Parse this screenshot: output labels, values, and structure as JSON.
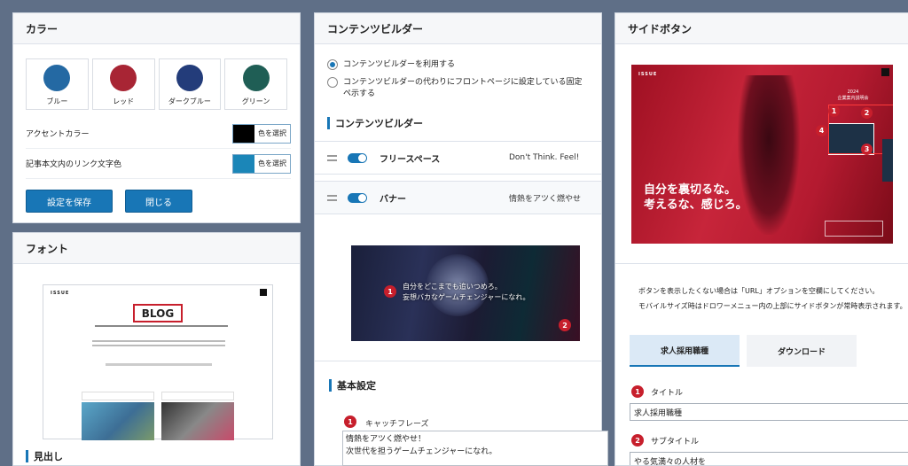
{
  "color_panel": {
    "title": "カラー",
    "swatches": [
      {
        "label": "ブルー",
        "color": "#2469a3"
      },
      {
        "label": "レッド",
        "color": "#a82534"
      },
      {
        "label": "ダークブルー",
        "color": "#233c7a"
      },
      {
        "label": "グリーン",
        "color": "#1f5e55"
      }
    ],
    "accent_label": "アクセントカラー",
    "accent_color": "#000000",
    "link_label": "記事本文内のリンク文字色",
    "link_color": "#1b86b8",
    "pick_label": "色を選択",
    "save_label": "設定を保存",
    "close_label": "閉じる"
  },
  "font_panel": {
    "title": "フォント",
    "preview_logo": "ISSUE",
    "preview_heading": "BLOG",
    "section_label": "見出し"
  },
  "builder_panel": {
    "title": "コンテンツビルダー",
    "radio_use": "コンテンツビルダーを利用する",
    "radio_fixed": "コンテンツビルダーの代わりにフロントページに設定している固定ペ示する",
    "section_title": "コンテンツビルダー",
    "rows": [
      {
        "name": "フリースペース",
        "desc": "Don't Think. Feel!"
      },
      {
        "name": "バナー",
        "desc": "情熱をアツく燃やせ"
      }
    ],
    "banner_text_1": "自分をどこまでも追いつめろ。",
    "banner_text_2": "妄想バカなゲームチェンジャーになれ。",
    "basic_settings": "基本設定",
    "catchphrase_label": "キャッチフレーズ",
    "catchphrase_line1": "情熱をアツく燃やせ！",
    "catchphrase_line2": "次世代を担うゲームチェンジャーになれ。"
  },
  "side_panel": {
    "title": "サイドボタン",
    "img_logo": "ISSUE",
    "img_line1": "自分を裏切るな。",
    "img_line2": "考えるな、感じろ。",
    "img_year": "2024",
    "img_event": "企業案内説明会",
    "note_1": "ボタンを表示したくない場合は「URL」オプションを空欄にしてください。",
    "note_2": "モバイルサイズ時はドロワーメニュー内の上部にサイドボタンが常時表示されます。",
    "tab_recruit": "求人採用職種",
    "tab_download": "ダウンロード",
    "title_label": "タイトル",
    "title_value": "求人採用職種",
    "subtitle_label": "サブタイトル",
    "subtitle_value": "やる気満々の人材を"
  },
  "markers": [
    "1",
    "2",
    "3",
    "4"
  ],
  "colors": {
    "primary": "#1876b6",
    "marker": "#c71f2c"
  }
}
